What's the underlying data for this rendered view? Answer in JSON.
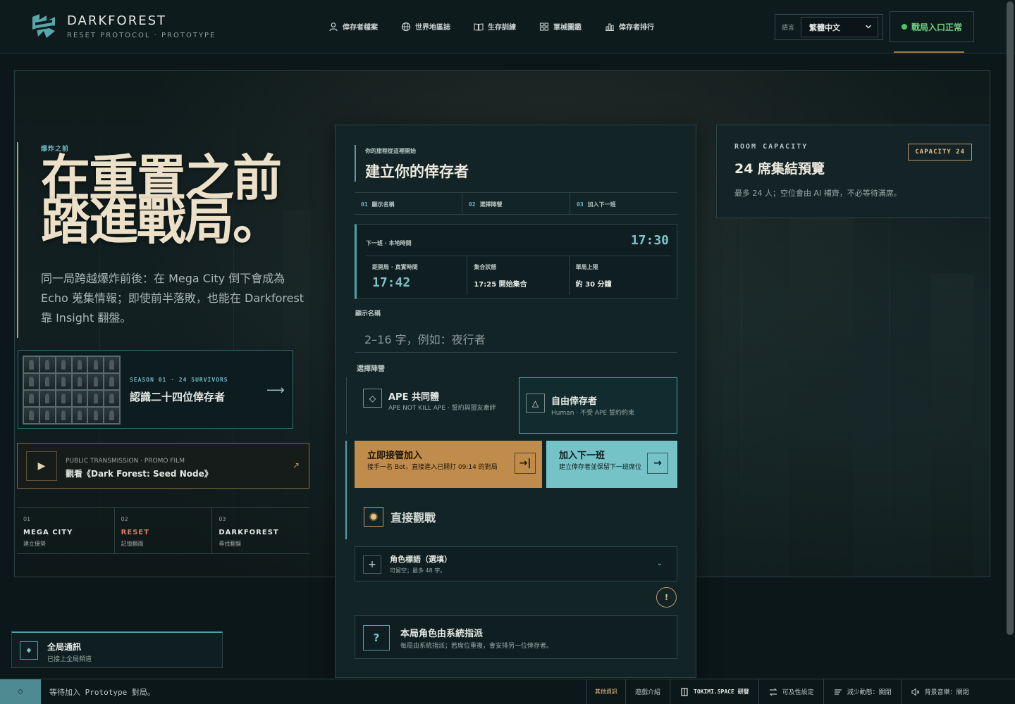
{
  "header": {
    "brand": "DARKFOREST",
    "brand_sub": "RESET PROTOCOL · PROTOTYPE",
    "nav": [
      {
        "label": "倖存者檔案",
        "icon": "user-icon"
      },
      {
        "label": "世界地區誌",
        "icon": "globe-icon"
      },
      {
        "label": "生存訓練",
        "icon": "book-icon"
      },
      {
        "label": "軍械圖鑑",
        "icon": "grid-icon"
      },
      {
        "label": "倖存者排行",
        "icon": "bar-chart-icon"
      }
    ],
    "lang_label": "語言",
    "lang_value": "繁體中文",
    "status": "戰局入口正常",
    "status_color": "#4ec465"
  },
  "hero": {
    "kicker": "爆炸之前",
    "title_line1": "在重置之前",
    "title_line2": "踏進戰局。",
    "body": "同一局跨越爆炸前後：在 Mega City 倒下會成為 Echo 蒐集情報；即使前半落敗，也能在 Darkforest 靠 Insight 翻盤。"
  },
  "survivors_card": {
    "kicker": "SEASON 01 · 24 SURVIVORS",
    "title": "認識二十四位倖存者"
  },
  "promo": {
    "kicker": "PUBLIC TRANSMISSION · PROMO FILM",
    "title": "觀看《Dark Forest: Seed Node》"
  },
  "steps": [
    {
      "num": "01",
      "name": "MEGA CITY",
      "sub": "建立優勢"
    },
    {
      "num": "02",
      "name": "RESET",
      "sub": "記憶翻面"
    },
    {
      "num": "03",
      "name": "DARKFOREST",
      "sub": "尋找翻盤"
    }
  ],
  "panel": {
    "kicker": "你的旅程從這裡開始",
    "title": "建立你的倖存者",
    "tabs": [
      {
        "num": "01",
        "label": "顯示名稱"
      },
      {
        "num": "02",
        "label": "選擇陣營"
      },
      {
        "num": "03",
        "label": "加入下一班"
      }
    ],
    "schedule": {
      "label": "下一班 · 本地時間",
      "time": "17:30",
      "cells": [
        {
          "label": "距開局 · 真實時間",
          "value": "17:42"
        },
        {
          "label": "集合狀態",
          "value": "17:25 開始集合"
        },
        {
          "label": "單局上限",
          "value": "約 30 分鐘"
        }
      ]
    },
    "name_label": "顯示名稱",
    "name_placeholder": "2–16 字，例如：夜行者",
    "faction_label": "選擇陣營",
    "factions": [
      {
        "icon": "◇",
        "name": "APE 共同體",
        "desc": "APE NOT KILL APE · 誓約與盟友牽絆"
      },
      {
        "icon": "△",
        "name": "自由倖存者",
        "desc": "Human · 不受 APE 誓約約束"
      }
    ],
    "join_now": {
      "title": "立即接管加入",
      "desc": "接手一名 Bot，直接進入已開打 09:14 的對局",
      "icon": "→|"
    },
    "join_next": {
      "title": "加入下一班",
      "desc": "建立倖存者並保留下一班席位",
      "icon": "→"
    },
    "spectate": "直接觀戰",
    "tag": {
      "title": "角色標語（選填）",
      "sub": "可留空；最多 48 字。",
      "chev": "⌄"
    },
    "warn": "!",
    "assign": {
      "icon": "?",
      "title": "本局角色由系統指派",
      "desc": "每局由系統指派；若席位重複，會安排另一位倖存者。"
    }
  },
  "capacity": {
    "kicker": "ROOM CAPACITY",
    "badge": "CAPACITY 24",
    "title": "24 席集結預覽",
    "desc": "最多 24 人；空位會由 AI 補齊，不必等待滿席。"
  },
  "notice": {
    "title": "全局通訊",
    "sub": "已接上全局頻道"
  },
  "footer": {
    "message": "等待加入 Prototype 對局。",
    "items": [
      "其他資訊",
      "遊戲介紹",
      "TOKIMI.SPACE 研發",
      "可及性設定",
      "減少動態：關閉",
      "背景音樂：關閉"
    ]
  }
}
